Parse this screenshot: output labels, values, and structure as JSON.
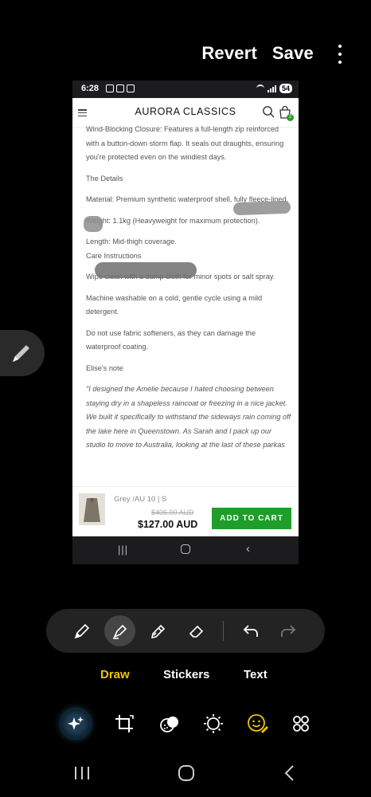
{
  "editor": {
    "revert_label": "Revert",
    "save_label": "Save",
    "more_icon": "more-vert-icon",
    "modes": [
      "Draw",
      "Stickers",
      "Text"
    ],
    "active_mode": "Draw",
    "tools": [
      "pen-icon",
      "highlighter-icon",
      "marker-icon",
      "eraser-icon",
      "undo-icon",
      "redo-icon"
    ],
    "bottom_tools": [
      "ai-sparkle-icon",
      "crop-icon",
      "filter-icon",
      "brightness-icon",
      "sticker-face-icon",
      "more-apps-icon"
    ]
  },
  "screenshot": {
    "status_time": "6:28",
    "battery": "54",
    "brand": "AURORA CLASSICS",
    "cart_count": "2",
    "paragraphs": [
      "Wind-Blocking Closure: Features a full-length zip reinforced with a button-down storm flap. It seals out draughts, ensuring you're protected even on the windiest days.",
      "The Details",
      "Material: Premium synthetic waterproof shell, fully fleece-lined.",
      "Weight: 1.1kg (Heavyweight for maximum protection).",
      "Length: Mid-thigh coverage.",
      "Care Instructions",
      "Wipe clean with a damp cloth for minor spots or salt spray.",
      "Machine washable on a cold, gentle cycle using a mild detergent.",
      "Do not use fabric softeners, as they can damage the waterproof coating.",
      "Elise's note",
      "\"I designed the Amélie because I hated choosing between staying dry in a shapeless raincoat or freezing in a nice jacket. We built it specifically to withstand the sideways rain coming off the lake here in Queenstown. As Sarah and I pack up our studio to move to Australia, looking at the last of these parkas"
    ],
    "product": {
      "variant": "Grey /AU 10 | S",
      "old_price": "$406.00 AUD",
      "price": "$127.00 AUD",
      "cta": "ADD TO CART"
    }
  },
  "colors": {
    "accent_mode": "#f0c400",
    "cart_green": "#1f9d2a"
  }
}
